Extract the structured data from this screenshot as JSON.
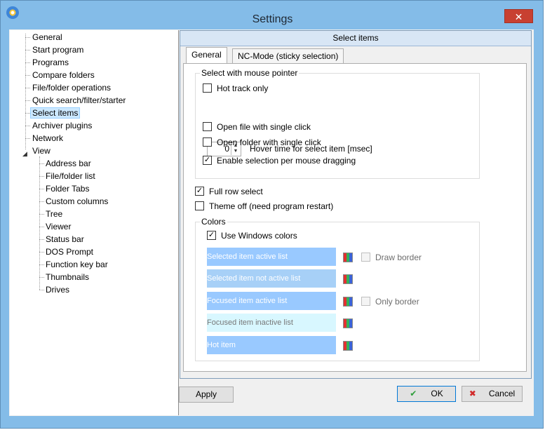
{
  "window": {
    "title": "Settings",
    "close": "✕"
  },
  "tree": {
    "items": [
      "General",
      "Start program",
      "Programs",
      "Compare folders",
      "File/folder operations",
      "Quick search/filter/starter",
      "Select items",
      "Archiver plugins",
      "Network",
      "View",
      "Address bar",
      "File/folder list",
      "Folder Tabs",
      "Custom columns",
      "Tree",
      "Viewer",
      "Status bar",
      "DOS Prompt",
      "Function key bar",
      "Thumbnails",
      "Drives"
    ],
    "expand_icon": "◢"
  },
  "panel": {
    "header": "Select items",
    "tabs": [
      "General",
      "NC-Mode (sticky selection)"
    ],
    "mouse_group": {
      "title": "Select with mouse pointer",
      "hot_track": "Hot track only",
      "hover_value": "0",
      "hover_label": "Hover time for select item [msec]",
      "open_file": "Open file with single click",
      "open_folder": "Open folder with single click",
      "dragging": "Enable selection per mouse dragging"
    },
    "full_row": "Full row select",
    "theme_off": "Theme off (need program restart)",
    "colors": {
      "title": "Colors",
      "use_windows": "Use Windows colors",
      "items": [
        "Selected item active list",
        "Selected item not active list",
        "Focused item active list",
        "Focused item inactive list",
        "Hot item"
      ],
      "draw_border": "Draw border",
      "only_border": "Only border"
    }
  },
  "buttons": {
    "apply": "Apply",
    "ok": "OK",
    "cancel": "Cancel",
    "ok_icon": "✔",
    "cancel_icon": "✖"
  }
}
